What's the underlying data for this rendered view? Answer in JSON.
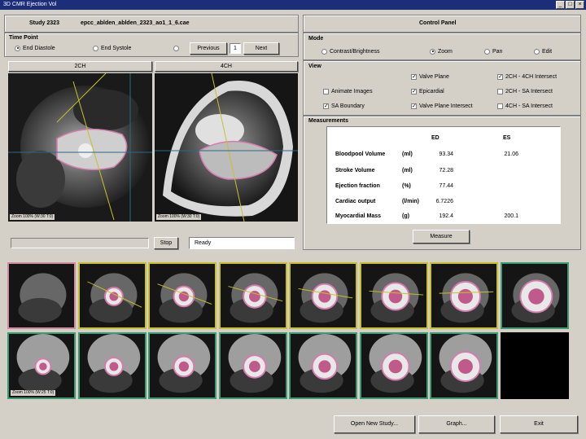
{
  "window": {
    "title": "3D CMR Ejection Vol"
  },
  "study": {
    "label": "Study 2323",
    "file": "epcc_ablden_ablden_2323_ao1_1_6.cae"
  },
  "time_point": {
    "label": "Time Point",
    "end_diastole": "End Diastole",
    "end_systole": "End Systole",
    "previous": "Previous",
    "frame": "1",
    "next": "Next"
  },
  "views": {
    "left_header": "2CH",
    "right_header": "4CH",
    "left_caption": "Zoom 100% (W:30 T:0)",
    "right_caption": "Zoom 100% (W:30 T:0)"
  },
  "progress": {
    "stop": "Stop",
    "status": "Ready",
    "fraction": 0
  },
  "control": {
    "title": "Control Panel",
    "mode_label": "Mode",
    "modes": [
      "Contrast/Brightness",
      "Zoom",
      "Pan",
      "Edit"
    ],
    "selected_mode": "Zoom"
  },
  "view_opts": {
    "label": "View",
    "animate": "Animate Images",
    "sa_boundary": "SA Boundary",
    "valve_plane": "Valve Plane",
    "epicardial": "Epicardial",
    "valve_plane_intersect": "Valve Plane Intersect",
    "ch2_4_intersect": "2CH - 4CH Intersect",
    "ch2_sa_intersect": "2CH - SA Intersect",
    "ch4_sa_intersect": "4CH - SA Intersect"
  },
  "measurements": {
    "label": "Measurements",
    "ed": "ED",
    "es": "ES",
    "rows": [
      {
        "name": "Bloodpool Volume",
        "unit": "(ml)",
        "ed": "93.34",
        "es": "21.06"
      },
      {
        "name": "Stroke Volume",
        "unit": "(ml)",
        "ed": "72.28",
        "es": ""
      },
      {
        "name": "Ejection fraction",
        "unit": "(%)",
        "ed": "77.44",
        "es": ""
      },
      {
        "name": "Cardiac output",
        "unit": "(l/min)",
        "ed": "6.7226",
        "es": ""
      },
      {
        "name": "Myocardial Mass",
        "unit": "(g)",
        "ed": "192.4",
        "es": "200.1"
      }
    ],
    "measure": "Measure"
  },
  "thumbs": {
    "caption": "Zoom 100% (W:25 T:0)"
  },
  "footer": {
    "open": "Open New Study...",
    "graph": "Graph...",
    "exit": "Exit"
  },
  "colors": {
    "titlebar": "#1c2d7a",
    "yellow": "#c8c02a",
    "green": "#3f9a74",
    "pink": "#d08aa0",
    "contour": "#d77ab0"
  }
}
